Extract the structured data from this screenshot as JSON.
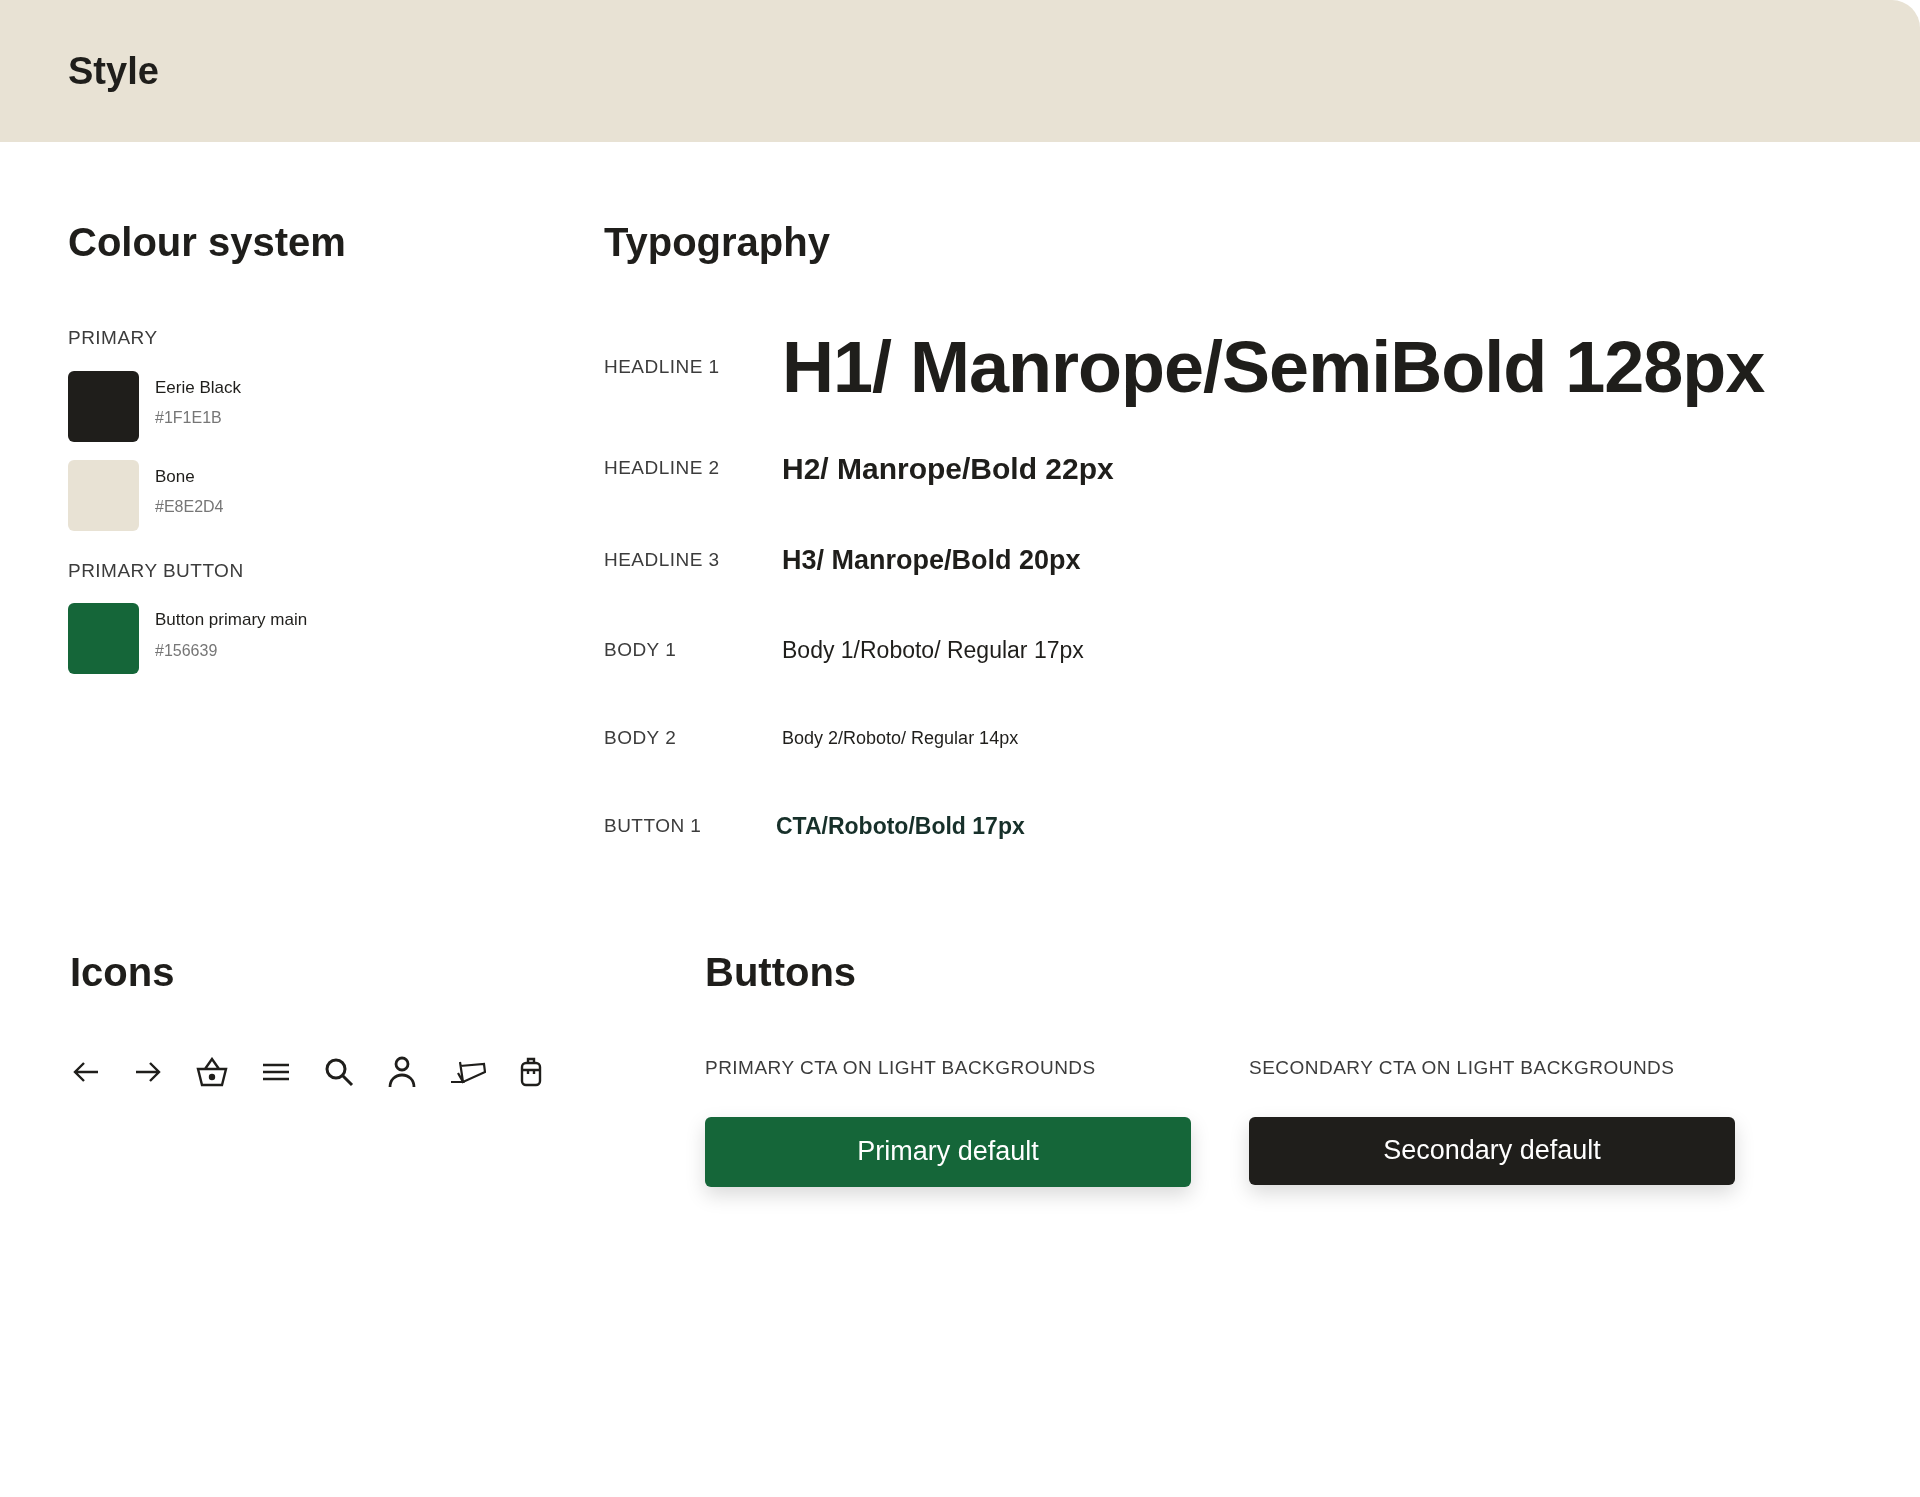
{
  "header": {
    "title": "Style"
  },
  "colour_system": {
    "title": "Colour system",
    "groups": [
      {
        "label": "PRIMARY",
        "swatches": [
          {
            "name": "Eerie Black",
            "hex": "#1F1E1B",
            "color": "#1f1e1b"
          },
          {
            "name": "Bone",
            "hex": "#E8E2D4",
            "color": "#e8e2d4"
          }
        ]
      },
      {
        "label": "PRIMARY BUTTON",
        "swatches": [
          {
            "name": "Button primary main",
            "hex": "#156639",
            "color": "#156639"
          }
        ]
      }
    ]
  },
  "typography": {
    "title": "Typography",
    "rows": [
      {
        "label": "HEADLINE 1",
        "sample": "H1/ Manrope/SemiBold 128px",
        "kind": "h1"
      },
      {
        "label": "HEADLINE 2",
        "sample": "H2/ Manrope/Bold 22px",
        "kind": "h2"
      },
      {
        "label": "HEADLINE 3",
        "sample": "H3/ Manrope/Bold 20px",
        "kind": "h3"
      },
      {
        "label": "BODY 1",
        "sample": "Body 1/Roboto/ Regular 17px",
        "kind": "body1"
      },
      {
        "label": "BODY 2",
        "sample": "Body 2/Roboto/ Regular 14px",
        "kind": "body2"
      },
      {
        "label": "BUTTON 1",
        "sample": "CTA/Roboto/Bold 17px",
        "kind": "button"
      }
    ]
  },
  "icons": {
    "title": "Icons"
  },
  "buttons": {
    "title": "Buttons",
    "items": [
      {
        "label": "PRIMARY CTA ON LIGHT BACKGROUNDS",
        "text": "Primary default",
        "kind": "primary"
      },
      {
        "label": "SECONDARY CTA ON LIGHT BACKGROUNDS",
        "text": "Secondary default",
        "kind": "secondary"
      }
    ]
  }
}
